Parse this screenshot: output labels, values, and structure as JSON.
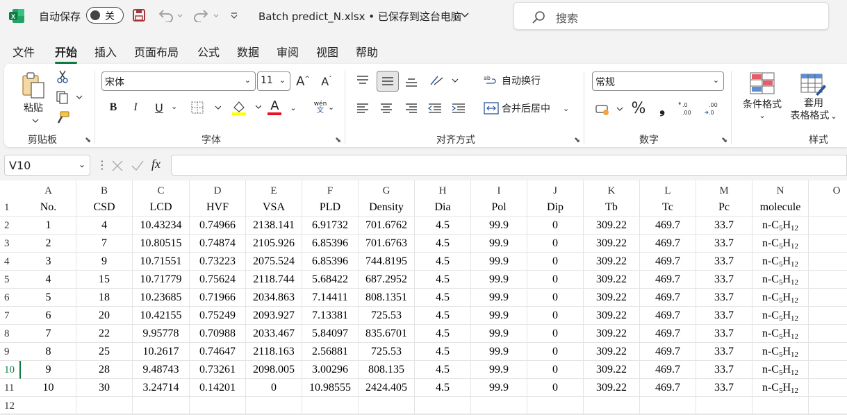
{
  "titlebar": {
    "autosave_label": "自动保存",
    "autosave_state": "关",
    "filename": "Batch predict_N.xlsx • 已保存到这台电脑",
    "search_placeholder": "搜索"
  },
  "menu": [
    "文件",
    "开始",
    "插入",
    "页面布局",
    "公式",
    "数据",
    "审阅",
    "视图",
    "帮助"
  ],
  "menu_active_index": 1,
  "ribbon": {
    "paste_label": "粘贴",
    "clipboard_group": "剪贴板",
    "font_name": "宋体",
    "font_size": "11",
    "font_group": "字体",
    "wrap_text": "自动换行",
    "merge_center": "合并后居中",
    "alignment_group": "对齐方式",
    "number_format": "常规",
    "number_group": "数字",
    "conditional_format": "条件格式",
    "table_format_1": "套用",
    "table_format_2": "表格格式",
    "styles_group": "样式",
    "bold": "B",
    "italic": "I",
    "underline": "U",
    "font_color": "A",
    "phonetic": "wén",
    "phonetic_char": "文",
    "percent": "%",
    "comma": "❟",
    "inc_dec": "←.0 .00",
    "dec_dec": ".00 →.0",
    "fx": "fx"
  },
  "namebox": "V10",
  "columns": [
    "A",
    "B",
    "C",
    "D",
    "E",
    "F",
    "G",
    "H",
    "I",
    "J",
    "K",
    "L",
    "M",
    "N",
    "O"
  ],
  "rows": [
    "1",
    "2",
    "3",
    "4",
    "5",
    "6",
    "7",
    "8",
    "9",
    "10",
    "11",
    "12"
  ],
  "selected_row": "10",
  "table": {
    "headers": [
      "No.",
      "CSD",
      "LCD",
      "HVF",
      "VSA",
      "PLD",
      "Density",
      "Dia",
      "Pol",
      "Dip",
      "Tb",
      "Tc",
      "Pc",
      "molecule"
    ],
    "molecule": {
      "prefix": "n-C",
      "sub1": "5",
      "mid": "H",
      "sub2": "12"
    },
    "data": [
      [
        "1",
        "4",
        "10.43234",
        "0.74966",
        "2138.141",
        "6.91732",
        "701.6762",
        "4.5",
        "99.9",
        "0",
        "309.22",
        "469.7",
        "33.7"
      ],
      [
        "2",
        "7",
        "10.80515",
        "0.74874",
        "2105.926",
        "6.85396",
        "701.6763",
        "4.5",
        "99.9",
        "0",
        "309.22",
        "469.7",
        "33.7"
      ],
      [
        "3",
        "9",
        "10.71551",
        "0.73223",
        "2075.524",
        "6.85396",
        "744.8195",
        "4.5",
        "99.9",
        "0",
        "309.22",
        "469.7",
        "33.7"
      ],
      [
        "4",
        "15",
        "10.71779",
        "0.75624",
        "2118.744",
        "5.68422",
        "687.2952",
        "4.5",
        "99.9",
        "0",
        "309.22",
        "469.7",
        "33.7"
      ],
      [
        "5",
        "18",
        "10.23685",
        "0.71966",
        "2034.863",
        "7.14411",
        "808.1351",
        "4.5",
        "99.9",
        "0",
        "309.22",
        "469.7",
        "33.7"
      ],
      [
        "6",
        "20",
        "10.42155",
        "0.75249",
        "2093.927",
        "7.13381",
        "725.53",
        "4.5",
        "99.9",
        "0",
        "309.22",
        "469.7",
        "33.7"
      ],
      [
        "7",
        "22",
        "9.95778",
        "0.70988",
        "2033.467",
        "5.84097",
        "835.6701",
        "4.5",
        "99.9",
        "0",
        "309.22",
        "469.7",
        "33.7"
      ],
      [
        "8",
        "25",
        "10.2617",
        "0.74647",
        "2118.163",
        "2.56881",
        "725.53",
        "4.5",
        "99.9",
        "0",
        "309.22",
        "469.7",
        "33.7"
      ],
      [
        "9",
        "28",
        "9.48743",
        "0.73261",
        "2098.005",
        "3.00296",
        "808.135",
        "4.5",
        "99.9",
        "0",
        "309.22",
        "469.7",
        "33.7"
      ],
      [
        "10",
        "30",
        "3.24714",
        "0.14201",
        "0",
        "10.98555",
        "2424.405",
        "4.5",
        "99.9",
        "0",
        "309.22",
        "469.7",
        "33.7"
      ]
    ]
  },
  "colors": {
    "accent": "#107c41",
    "excel_green": "#107c41"
  }
}
